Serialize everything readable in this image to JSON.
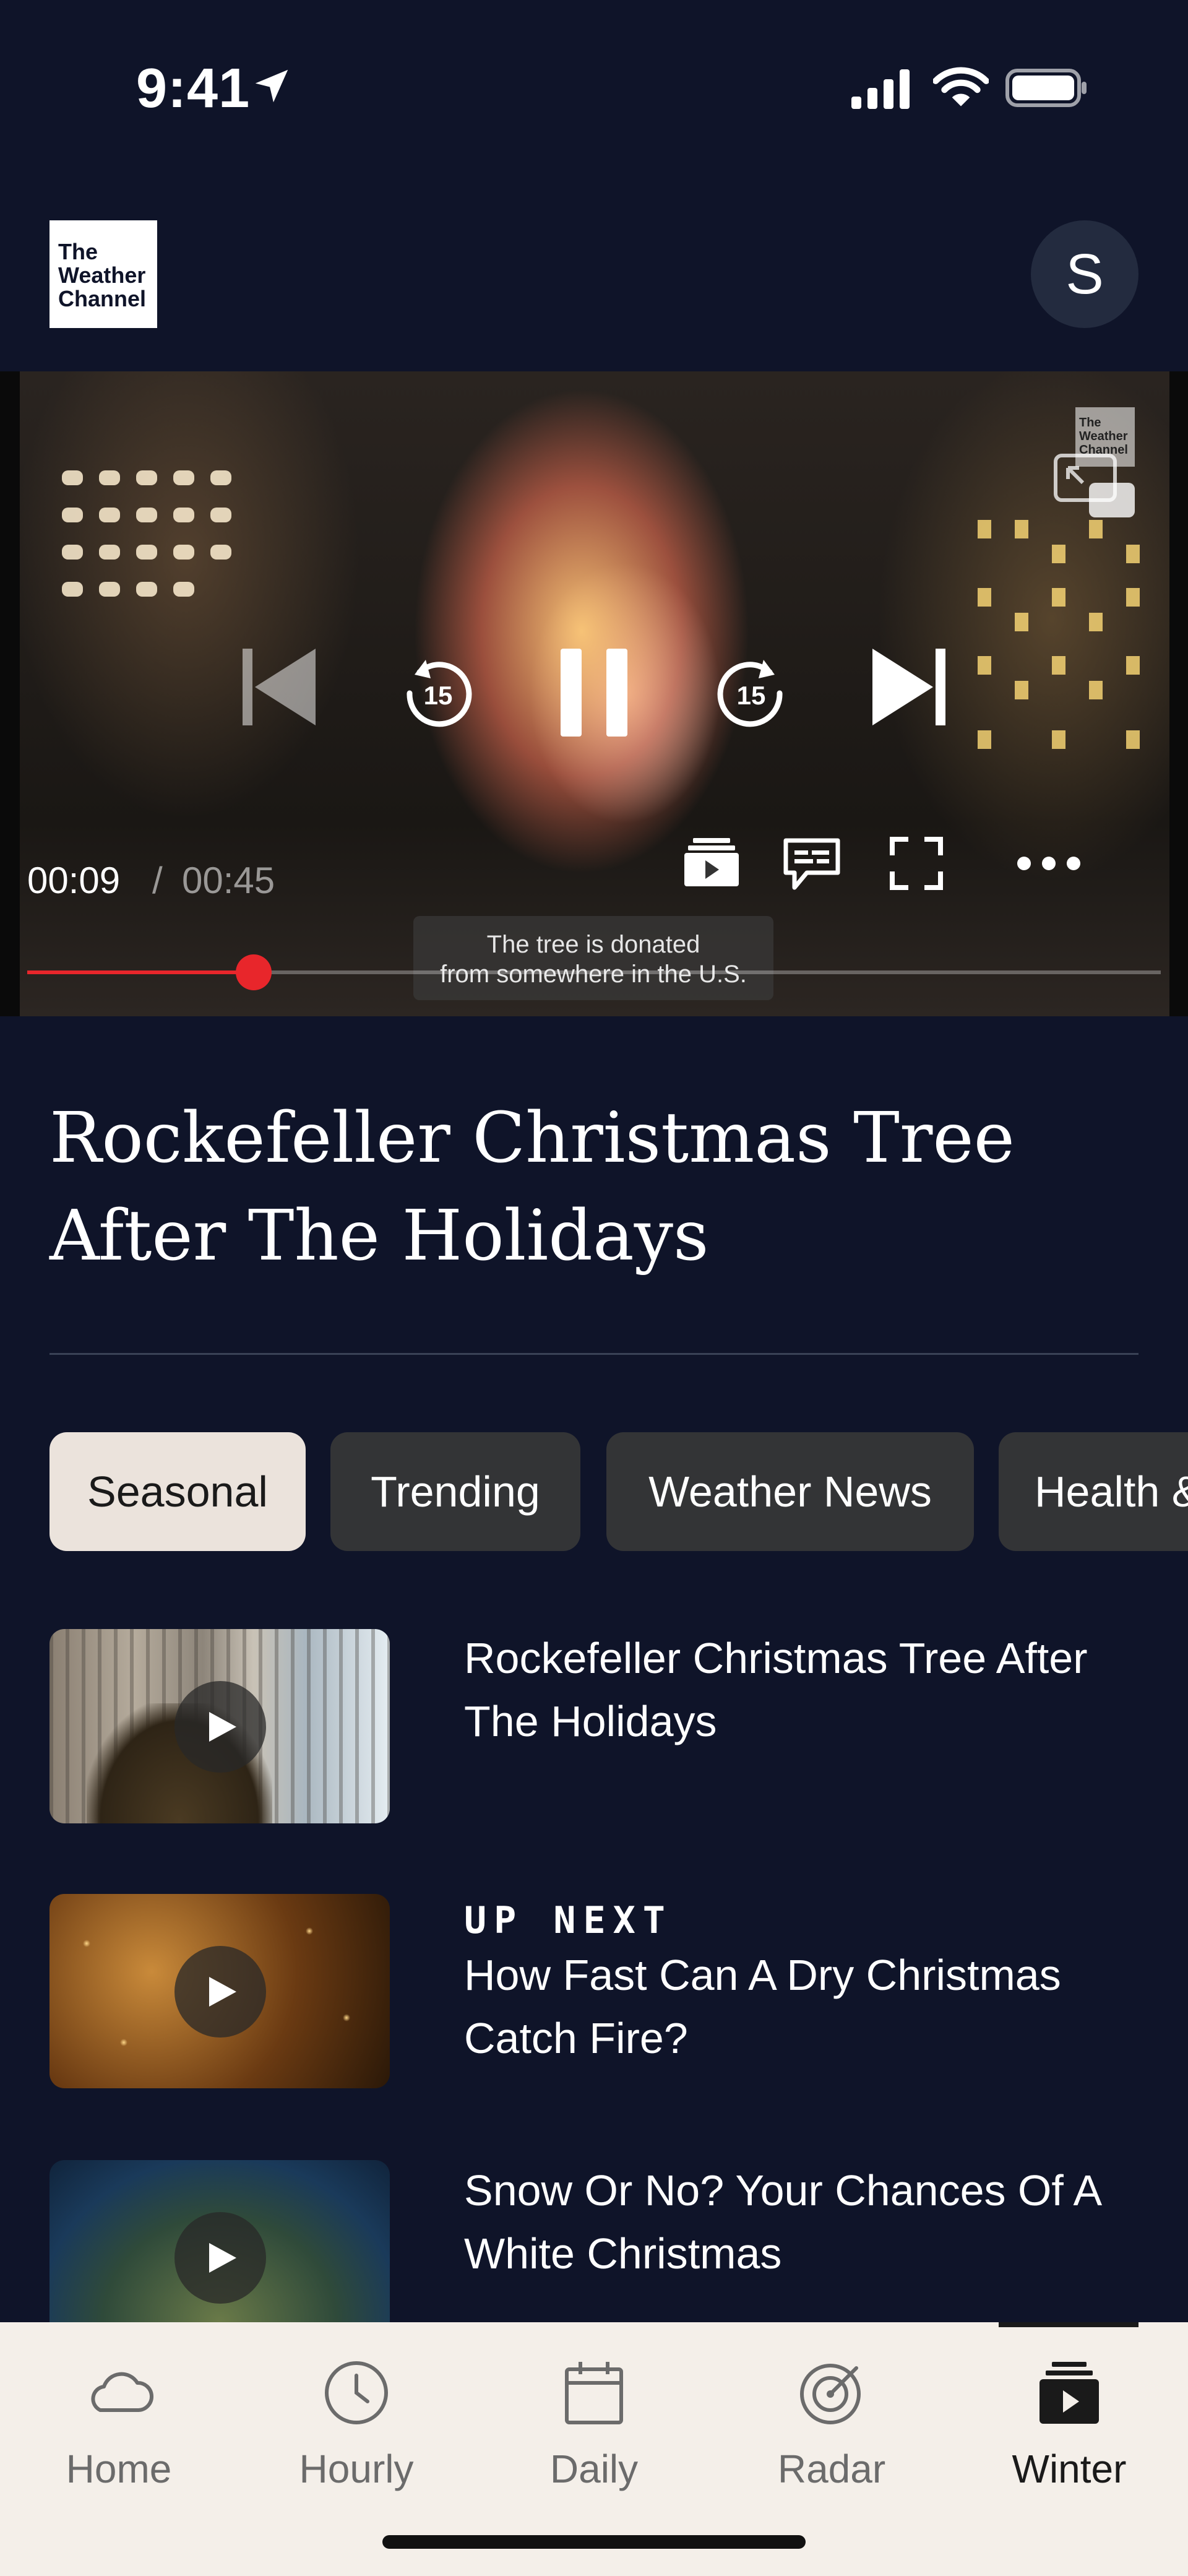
{
  "status_bar": {
    "time": "9:41"
  },
  "header": {
    "logo_lines": [
      "The",
      "Weather",
      "Channel"
    ],
    "avatar_initial": "S"
  },
  "player": {
    "current_time": "00:09",
    "separator": "/",
    "total_time": "00:45",
    "progress_fraction": 0.2,
    "caption_lines": [
      "The tree is donated",
      "from somewhere in the U.S."
    ],
    "watermark_lines": [
      "The",
      "Weather",
      "Channel"
    ],
    "accent_color": "#e8262b"
  },
  "video": {
    "title": "Rockefeller Christmas Tree After The Holidays"
  },
  "chips": [
    {
      "label": "Seasonal",
      "active": true
    },
    {
      "label": "Trending",
      "active": false
    },
    {
      "label": "Weather News",
      "active": false
    },
    {
      "label": "Health &",
      "active": false
    }
  ],
  "playlist": [
    {
      "title": "Rockefeller Christmas Tree After The Holidays",
      "tag": ""
    },
    {
      "title": "How Fast Can A Dry Christmas Catch Fire?",
      "tag": "UP NEXT"
    },
    {
      "title": "Snow Or No? Your Chances Of A White Christmas",
      "tag": ""
    }
  ],
  "tab_bar": {
    "tabs": [
      {
        "label": "Home",
        "icon": "cloud-icon"
      },
      {
        "label": "Hourly",
        "icon": "clock-icon"
      },
      {
        "label": "Daily",
        "icon": "calendar-icon"
      },
      {
        "label": "Radar",
        "icon": "radar-icon"
      },
      {
        "label": "Winter",
        "icon": "video-stack-icon"
      }
    ],
    "active": "Winter"
  }
}
